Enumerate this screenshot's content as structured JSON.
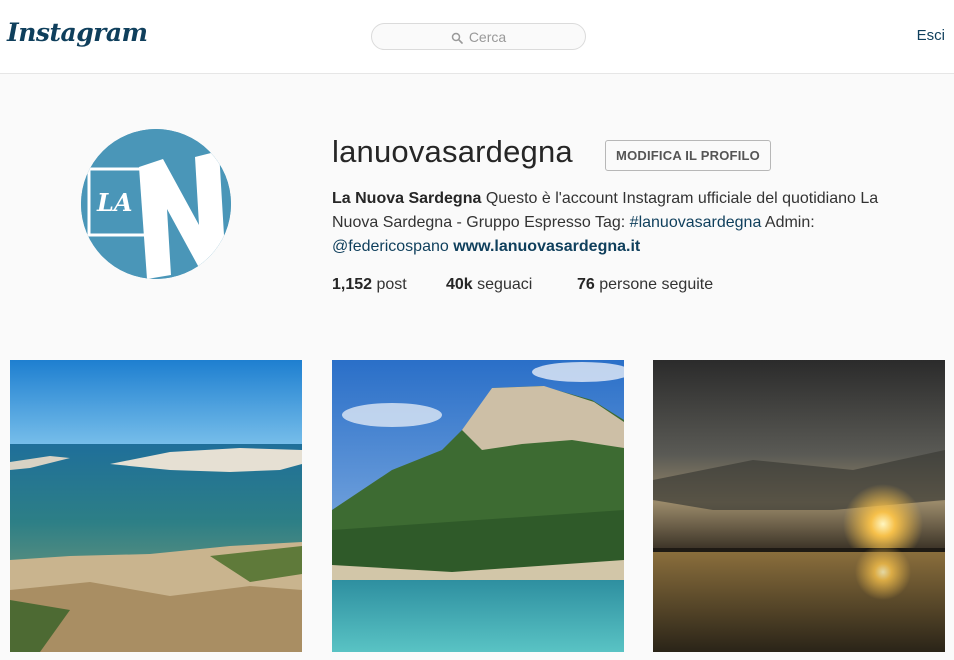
{
  "header": {
    "logo_text": "Instagram",
    "search_placeholder": "Cerca",
    "logout_label": "Esci"
  },
  "profile": {
    "username": "lanuovasardegna",
    "edit_button_label": "MODIFICA IL PROFILO",
    "avatar_text": "LA N",
    "bio": {
      "full_name": "La Nuova Sardegna",
      "text": "Questo è l'account Instagram ufficiale del quotidiano La Nuova Sardegna - Gruppo Espresso Tag:",
      "hashtag": "#lanuovasardegna",
      "admin_label": "Admin:",
      "mention": "@federicospano",
      "website": "www.lanuovasardegna.it"
    },
    "stats": {
      "posts_count": "1,152",
      "posts_label": "post",
      "followers_count": "40k",
      "followers_label": "seguaci",
      "following_count": "76",
      "following_label": "persone seguite"
    }
  },
  "posts": [
    {
      "subject": "rocky coastline with clear blue sea"
    },
    {
      "subject": "green hill with rock cliff above turquoise water"
    },
    {
      "subject": "sunset over calm water"
    }
  ],
  "colors": {
    "brand": "#0f3f5c",
    "avatar_bg": "#4a96b8",
    "border": "#dbdbdb"
  },
  "icons": [
    "search-icon"
  ]
}
